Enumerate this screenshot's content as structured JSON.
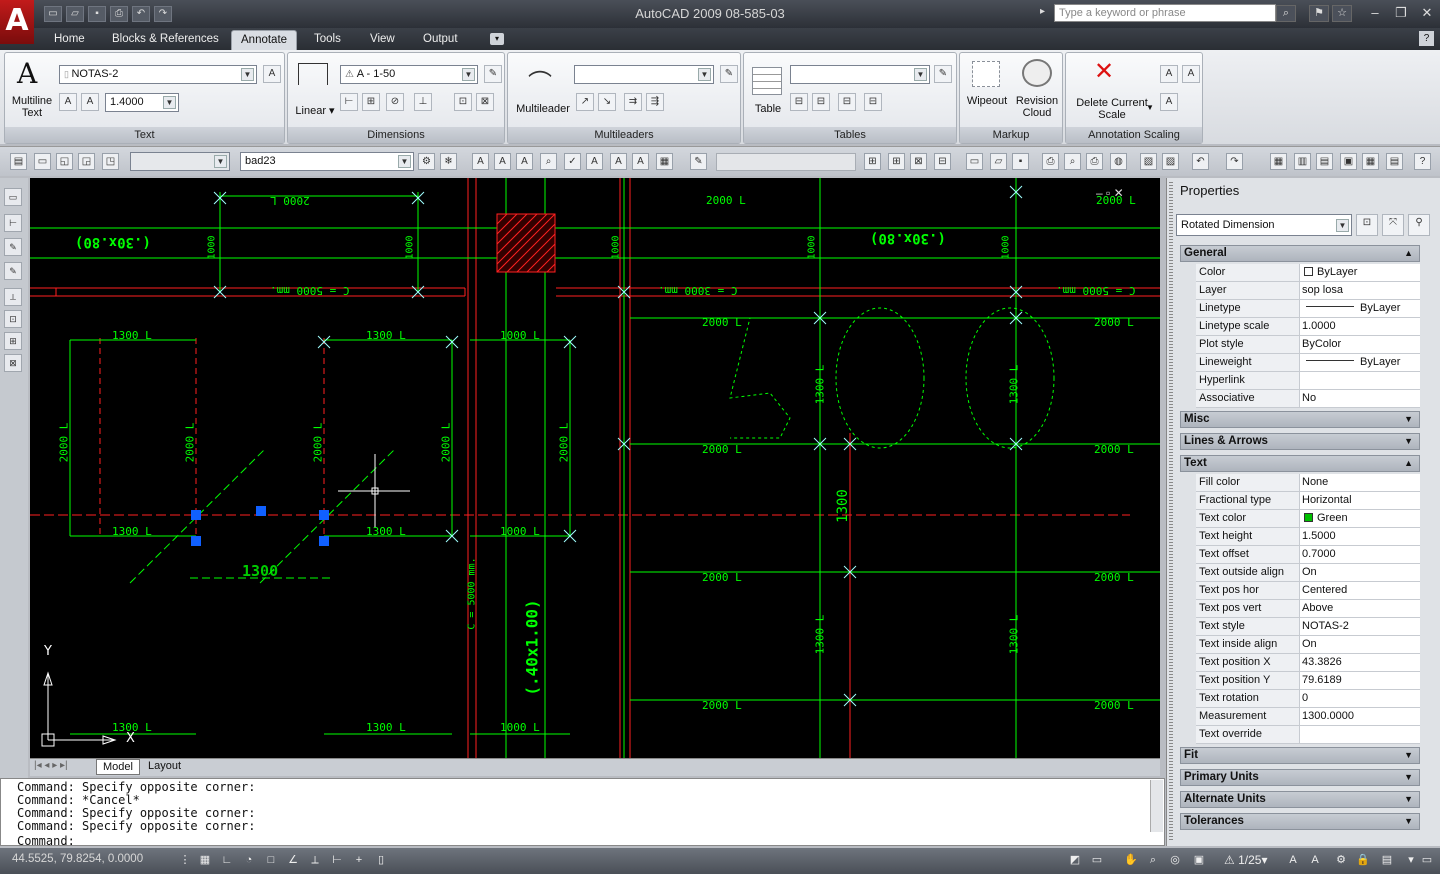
{
  "app": {
    "logo": "A",
    "title": "AutoCAD 2009  08-585-03",
    "search_placeholder": "Type a keyword or phrase"
  },
  "ribbon_tabs": [
    "Home",
    "Blocks & References",
    "Annotate",
    "Tools",
    "View",
    "Output"
  ],
  "active_tab": "Annotate",
  "panels": {
    "text": {
      "title": "Text",
      "big_label": "Multiline\nText",
      "style": "NOTAS-2",
      "height": "1.4000"
    },
    "dimensions": {
      "title": "Dimensions",
      "big_label": "Linear",
      "dimstyle": "A - 1-50"
    },
    "multileaders": {
      "title": "Multileaders",
      "big_label": "Multileader",
      "style": ""
    },
    "tables": {
      "title": "Tables",
      "big_label": "Table",
      "style": ""
    },
    "markup": {
      "title": "Markup",
      "wipeout": "Wipeout",
      "revision_cloud": "Revision\nCloud"
    },
    "scaling": {
      "title": "Annotation Scaling",
      "delete_scale": "Delete Current\nScale"
    }
  },
  "toolbar2": {
    "layer": "bad23",
    "layer_state": ""
  },
  "model_tabs": [
    "Model",
    "Layout"
  ],
  "command_lines": [
    "Command: Specify opposite corner:",
    "Command: *Cancel*",
    "Command: Specify opposite corner:",
    "Command: Specify opposite corner:"
  ],
  "command_prompt": "Command:",
  "status": {
    "coords": "44.5525, 79.8254, 0.0000",
    "scale": "1/25"
  },
  "properties": {
    "title": "Properties",
    "object_type": "Rotated Dimension",
    "sections": [
      {
        "name": "General",
        "expanded": true,
        "rows": [
          {
            "name": "Color",
            "value": "ByLayer"
          },
          {
            "name": "Layer",
            "value": "sop losa"
          },
          {
            "name": "Linetype",
            "value": "ByLayer"
          },
          {
            "name": "Linetype scale",
            "value": "1.0000"
          },
          {
            "name": "Plot style",
            "value": "ByColor"
          },
          {
            "name": "Lineweight",
            "value": "ByLayer"
          },
          {
            "name": "Hyperlink",
            "value": ""
          },
          {
            "name": "Associative",
            "value": "No"
          }
        ]
      },
      {
        "name": "Misc",
        "expanded": false,
        "rows": []
      },
      {
        "name": "Lines & Arrows",
        "expanded": false,
        "rows": []
      },
      {
        "name": "Text",
        "expanded": true,
        "rows": [
          {
            "name": "Fill color",
            "value": "None"
          },
          {
            "name": "Fractional type",
            "value": "Horizontal"
          },
          {
            "name": "Text color",
            "value": "Green"
          },
          {
            "name": "Text height",
            "value": "1.5000"
          },
          {
            "name": "Text offset",
            "value": "0.7000"
          },
          {
            "name": "Text outside align",
            "value": "On"
          },
          {
            "name": "Text pos hor",
            "value": "Centered"
          },
          {
            "name": "Text pos vert",
            "value": "Above"
          },
          {
            "name": "Text style",
            "value": "NOTAS-2"
          },
          {
            "name": "Text inside align",
            "value": "On"
          },
          {
            "name": "Text position X",
            "value": "43.3826"
          },
          {
            "name": "Text position Y",
            "value": "79.6189"
          },
          {
            "name": "Text rotation",
            "value": "0"
          },
          {
            "name": "Measurement",
            "value": "1300.0000"
          },
          {
            "name": "Text override",
            "value": ""
          }
        ]
      },
      {
        "name": "Fit",
        "expanded": false,
        "rows": []
      },
      {
        "name": "Primary Units",
        "expanded": false,
        "rows": []
      },
      {
        "name": "Alternate Units",
        "expanded": false,
        "rows": []
      },
      {
        "name": "Tolerances",
        "expanded": false,
        "rows": []
      }
    ]
  },
  "drawing": {
    "labels": [
      "2000 L",
      "1000",
      "(.30x.80)",
      "C = 5000 mm.",
      "C = 3000 mm.",
      "1300 L",
      "2000 L",
      "1000 L",
      "1300",
      "(.40x1.00)",
      "C = 5000 mm.",
      "300",
      "Y",
      "X"
    ],
    "colors": {
      "green": "#00ff00",
      "red": "#ff2020",
      "cyan": "#a0ffff",
      "grip": "#1060ff"
    }
  }
}
